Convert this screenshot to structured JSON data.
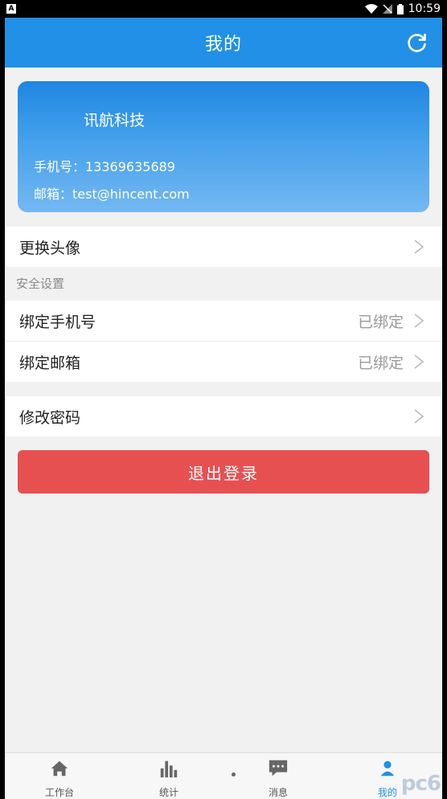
{
  "status_bar": {
    "time": "10:59",
    "app_badge": "A"
  },
  "header": {
    "title": "我的"
  },
  "profile": {
    "company": "讯航科技",
    "phone": "手机号：13369635689",
    "email": "邮箱：test@hincent.com"
  },
  "rows": {
    "avatar": "更换头像",
    "security_title": "安全设置",
    "bind_phone": "绑定手机号",
    "bind_phone_status": "已绑定",
    "bind_email": "绑定邮箱",
    "bind_email_status": "已绑定",
    "change_password": "修改密码"
  },
  "logout_label": "退出登录",
  "tabs": [
    {
      "label": "工作台",
      "icon": "home-icon"
    },
    {
      "label": "统计",
      "icon": "bar-chart-icon"
    },
    {
      "label": "消息",
      "icon": "chat-icon"
    },
    {
      "label": "我的",
      "icon": "user-icon"
    }
  ],
  "watermark": "pc6",
  "colors": {
    "primary": "#2190e6",
    "logout": "#e75050",
    "background": "#f1f1f1"
  }
}
